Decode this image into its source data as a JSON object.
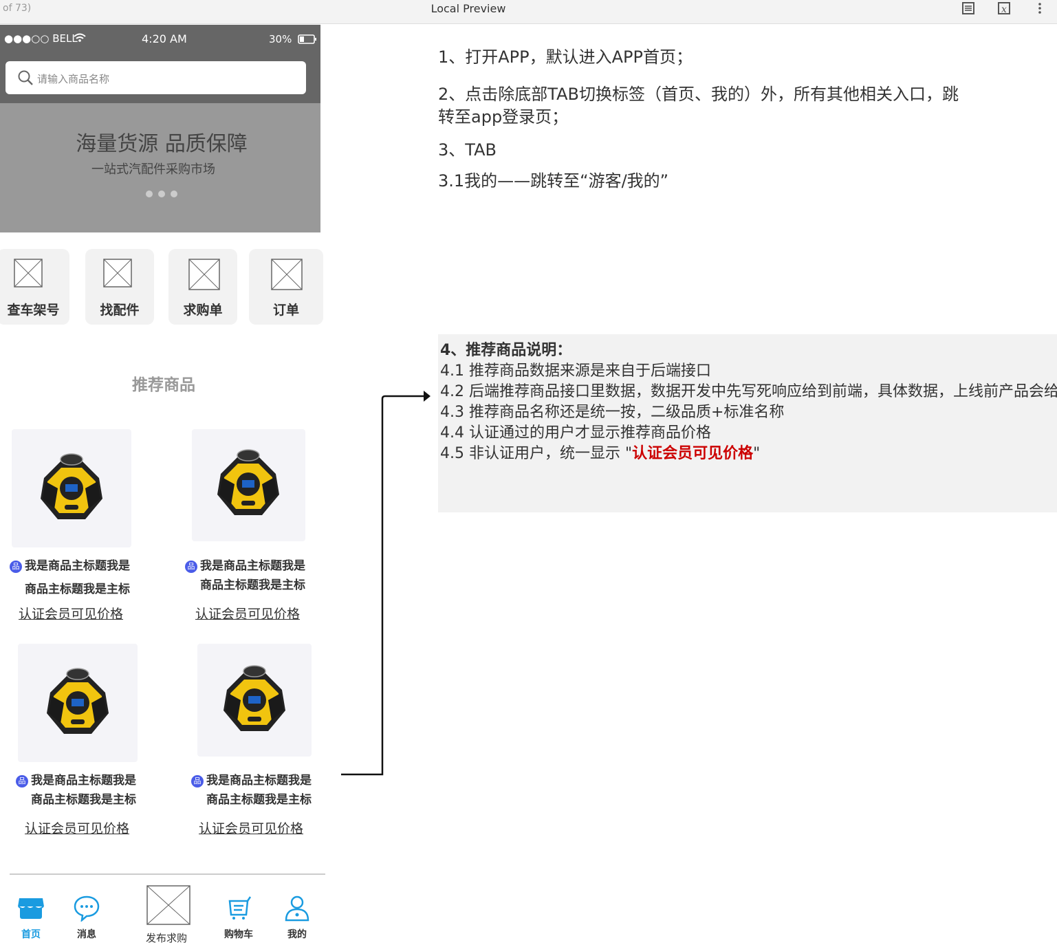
{
  "topbar": {
    "page_indicator": "of 73)",
    "title": "Local Preview",
    "icons": [
      "document-icon",
      "close-x-icon",
      "more-vertical-icon"
    ]
  },
  "status": {
    "carrier": "●●●○○ BELL",
    "time": "4:20 AM",
    "battery": "30%"
  },
  "search": {
    "placeholder": "请输入商品名称"
  },
  "banner": {
    "title": "海量货源 品质保障",
    "subtitle": "一站式汽配件采购市场"
  },
  "quick_actions": [
    {
      "label": "查车架号"
    },
    {
      "label": "找配件"
    },
    {
      "label": "求购单"
    },
    {
      "label": "订单"
    }
  ],
  "recommend": {
    "title": "推荐商品",
    "products": [
      {
        "badge": "品",
        "title_line1": "我是商品主标题我是",
        "title_line2": "商品主标题我是主标",
        "price": "认证会员可见价格"
      },
      {
        "badge": "品",
        "title_line1": "我是商品主标题我是",
        "title_line2": "商品主标题我是主标",
        "price": "认证会员可见价格"
      },
      {
        "badge": "品",
        "title_line1": "我是商品主标题我是",
        "title_line2": "商品主标题我是主标",
        "price": "认证会员可见价格"
      },
      {
        "badge": "品",
        "title_line1": "我是商品主标题我是",
        "title_line2": "商品主标题我是主标",
        "price": "认证会员可见价格"
      }
    ]
  },
  "tabbar": [
    {
      "label": "首页",
      "icon": "store-icon",
      "active": true
    },
    {
      "label": "消息",
      "icon": "chat-icon",
      "active": false
    },
    {
      "label": "发布求购",
      "icon": "image-placeholder-icon",
      "active": false
    },
    {
      "label": "购物车",
      "icon": "cart-icon",
      "active": false
    },
    {
      "label": "我的",
      "icon": "user-icon",
      "active": false
    }
  ],
  "notes": {
    "n1": "1、打开APP，默认进入APP首页；",
    "n2a": "2、点击除底部TAB切换标签（首页、我的）外，所有其他相关入口，跳",
    "n2b": "转至app登录页；",
    "n3": "3、TAB",
    "n31": "3.1我的——跳转至“游客/我的”"
  },
  "box4": {
    "heading": "4、推荐商品说明：",
    "l1": "4.1 推荐商品数据来源是来自于后端接口",
    "l2": "4.2 后端推荐商品接口里数据，数据开发中先写死响应给到前端，具体数据，上线前产品会给",
    "l3": "4.3 推荐商品名称还是统一按，二级品质+标准名称",
    "l4": "4.4 认证通过的用户才显示推荐商品价格",
    "l5_prefix": "4.5 非认证用户，统一显示 \"",
    "l5_highlight": "认证会员可见价格",
    "l5_suffix": "\""
  },
  "colors": {
    "accent_blue": "#1a9be0",
    "highlight_red": "#cc0000",
    "badge_blue": "#4a5ce8",
    "phone_gray": "#666666",
    "banner_gray": "#999999"
  }
}
